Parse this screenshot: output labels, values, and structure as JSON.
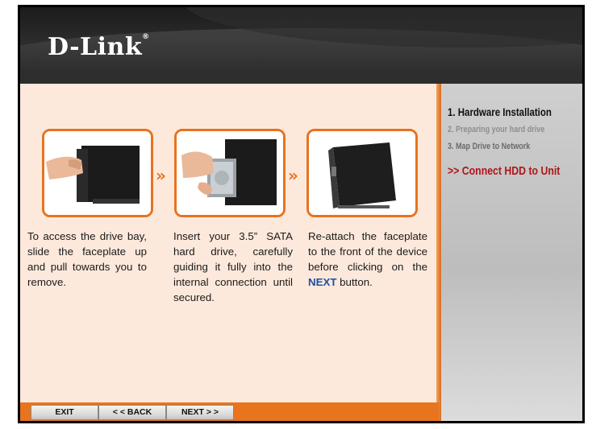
{
  "header": {
    "logo": "D-Link",
    "logo_mark": "®"
  },
  "steps": [
    {
      "text": "To access the drive bay, slide the faceplate up and pull towards you to remove."
    },
    {
      "text": "Insert your 3.5” SATA hard drive, carefully guiding it fully into the internal connection until secured."
    },
    {
      "text_before": "Re-attach the faceplate to the front of the device before clicking on the ",
      "text_highlight": "NEXT",
      "text_after": " button."
    }
  ],
  "arrows": [
    "»",
    "»"
  ],
  "sidebar": {
    "items": [
      {
        "label": "1.  Hardware Installation"
      },
      {
        "label": "2.  Preparing your hard drive"
      },
      {
        "label": "3.  Map Drive to Network"
      },
      {
        "label": ">> Connect HDD to Unit"
      }
    ]
  },
  "footer": {
    "buttons": [
      {
        "label": "EXIT"
      },
      {
        "label": "< < BACK"
      },
      {
        "label": "NEXT > >"
      }
    ]
  },
  "colors": {
    "accent": "#e8731e",
    "highlight": "#b0151c",
    "next_link": "#1f4fa0"
  },
  "icons": [
    "hand-removing-faceplate-photo",
    "hand-inserting-drive-photo",
    "assembled-unit-photo"
  ]
}
